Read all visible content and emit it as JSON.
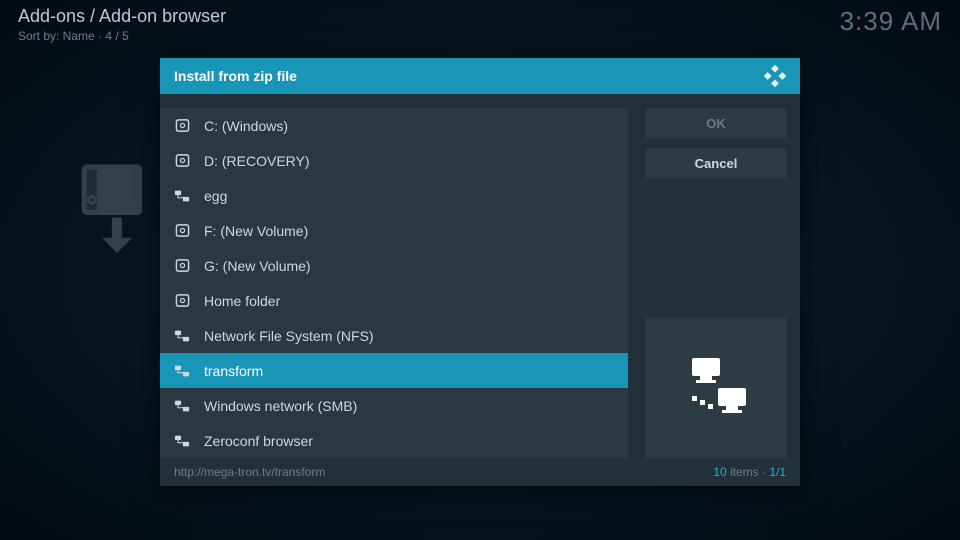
{
  "header": {
    "breadcrumb": "Add-ons / Add-on browser",
    "sort_line": "Sort by: Name  ·  4 / 5",
    "time": "3:39 AM"
  },
  "dialog": {
    "title": "Install from zip file",
    "items": [
      {
        "label": "C: (Windows)",
        "icon": "drive",
        "selected": false
      },
      {
        "label": "D: (RECOVERY)",
        "icon": "drive",
        "selected": false
      },
      {
        "label": "egg",
        "icon": "network",
        "selected": false
      },
      {
        "label": "F: (New Volume)",
        "icon": "drive",
        "selected": false
      },
      {
        "label": "G: (New Volume)",
        "icon": "drive",
        "selected": false
      },
      {
        "label": "Home folder",
        "icon": "drive",
        "selected": false
      },
      {
        "label": "Network File System (NFS)",
        "icon": "network",
        "selected": false
      },
      {
        "label": "transform",
        "icon": "network",
        "selected": true
      },
      {
        "label": "Windows network (SMB)",
        "icon": "network",
        "selected": false
      },
      {
        "label": "Zeroconf browser",
        "icon": "network",
        "selected": false
      }
    ],
    "buttons": {
      "ok": "OK",
      "cancel": "Cancel"
    },
    "footer": {
      "path": "http://mega-tron.tv/transform",
      "count_num": "10",
      "count_word": " items · ",
      "page": "1/1"
    }
  }
}
